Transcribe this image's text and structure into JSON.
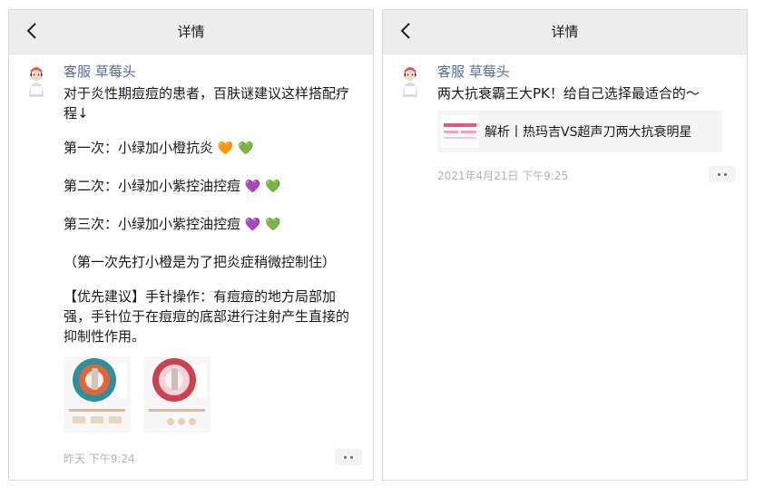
{
  "left_panel": {
    "header": {
      "title": "详情"
    },
    "post": {
      "username": "客服 草莓头",
      "paragraphs": [
        "对于炎性期痘痘的患者，百肤谜建议这样搭配疗程↓",
        "第一次：小绿加小橙抗炎",
        "第二次：小绿加小紫控油控痘",
        "第三次：小绿加小紫控油控痘",
        "（第一次先打小橙是为了把炎症稍微控制住）",
        "【优先建议】手针操作：有痘痘的地方局部加强，手针位于在痘痘的底部进行注射产生直接的抑制性作用。"
      ],
      "hearts": {
        "line1": [
          "🧡",
          "💚"
        ],
        "line2": [
          "💜",
          "💚"
        ],
        "line3": [
          "💜",
          "💚"
        ]
      },
      "timestamp": "昨天 下午9:24"
    }
  },
  "right_panel": {
    "header": {
      "title": "详情"
    },
    "post": {
      "username": "客服 草莓头",
      "text": "两大抗衰霸王大PK！给自己选择最适合的～",
      "link_title": "解析丨热玛吉VS超声刀两大抗衰明星",
      "timestamp": "2021年4月21日 下午9:25"
    }
  },
  "colors": {
    "header_bg": "#ededed",
    "name": "#576b95",
    "meta": "#b2b2b2",
    "link_bg": "#f5f5f5"
  },
  "icons": {
    "back": "chevron-left-icon",
    "more": "more-dots-icon"
  }
}
